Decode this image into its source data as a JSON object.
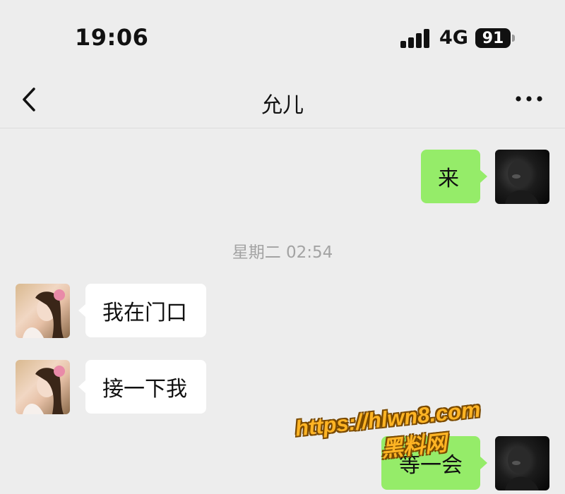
{
  "status_bar": {
    "time": "19:06",
    "network": "4G",
    "battery": "91"
  },
  "nav": {
    "title": "允儿",
    "back_icon": "chevron-left-icon",
    "more_icon": "more-horizontal-icon"
  },
  "messages": [
    {
      "side": "right",
      "text": "来"
    },
    {
      "side": "left",
      "text": "我在门口"
    },
    {
      "side": "left",
      "text": "接一下我"
    },
    {
      "side": "right",
      "text": "等一会"
    }
  ],
  "timestamp": "星期二 02:54",
  "watermark": {
    "line1": "https://hlwn8.com",
    "line2": "黑料网"
  },
  "colors": {
    "background": "#ededed",
    "outgoing_bubble": "#95ec69",
    "incoming_bubble": "#ffffff",
    "watermark": "#ffb424"
  }
}
